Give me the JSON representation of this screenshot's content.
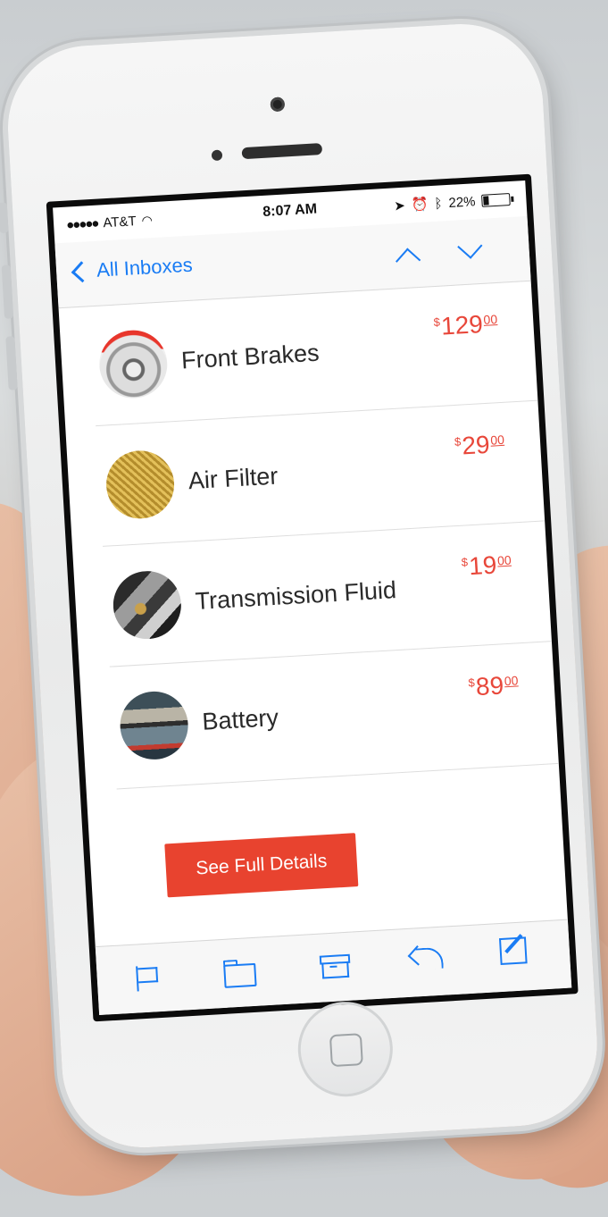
{
  "status_bar": {
    "carrier": "AT&T",
    "signal_dots": "●●●●●",
    "time": "8:07 AM",
    "battery": "22%",
    "battery_level": 0.22
  },
  "nav": {
    "back_label": "All Inboxes"
  },
  "items": [
    {
      "name": "Front Brakes",
      "currency": "$",
      "dollars": "129",
      "cents": "00",
      "icon": "brake-disc-image"
    },
    {
      "name": "Air Filter",
      "currency": "$",
      "dollars": "29",
      "cents": "00",
      "icon": "air-filter-image"
    },
    {
      "name": "Transmission Fluid",
      "currency": "$",
      "dollars": "19",
      "cents": "00",
      "icon": "transmission-image"
    },
    {
      "name": "Battery",
      "currency": "$",
      "dollars": "89",
      "cents": "00",
      "icon": "car-battery-image"
    }
  ],
  "cta_label": "See Full Details",
  "toolbar": [
    "flag-icon",
    "folder-icon",
    "archive-icon",
    "reply-icon",
    "compose-icon"
  ],
  "colors": {
    "accent_blue": "#1a7cf4",
    "price_red": "#e8473a",
    "button_red": "#e8432f"
  }
}
